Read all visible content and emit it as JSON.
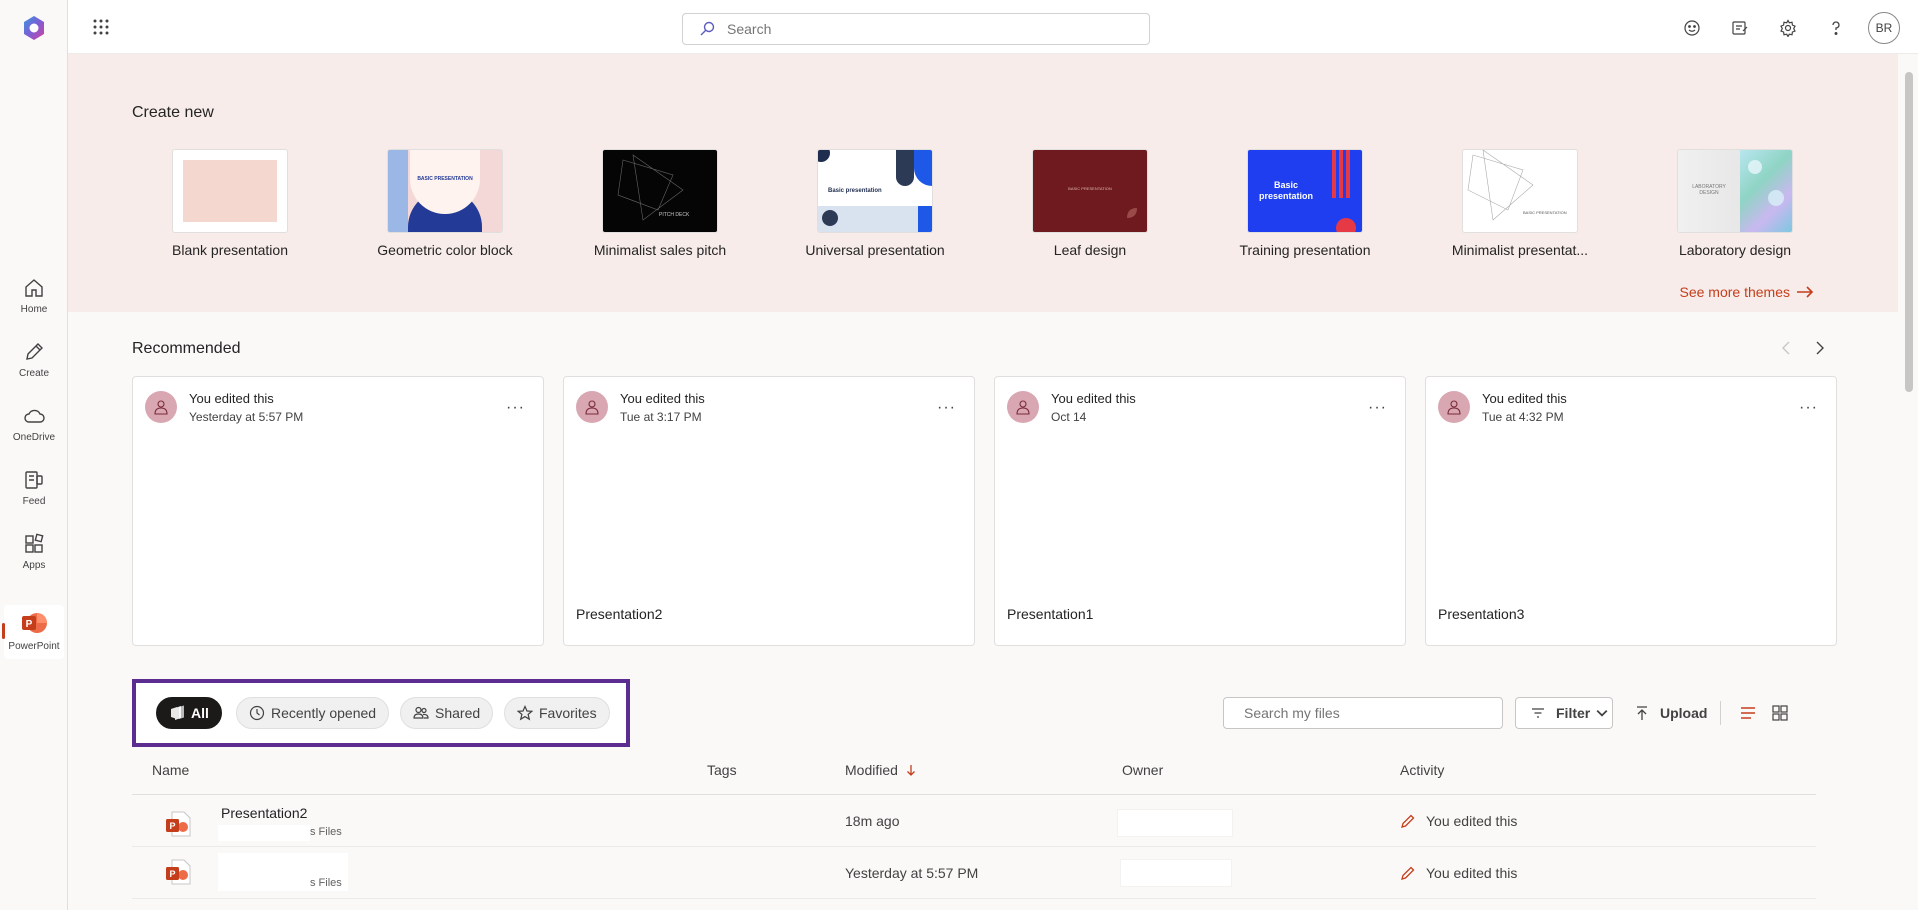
{
  "rail": {
    "items": [
      {
        "label": "Home",
        "icon": "home-icon"
      },
      {
        "label": "Create",
        "icon": "pen-icon"
      },
      {
        "label": "OneDrive",
        "icon": "cloud-icon"
      },
      {
        "label": "Feed",
        "icon": "feed-icon"
      },
      {
        "label": "Apps",
        "icon": "apps-icon"
      }
    ],
    "active_app": "PowerPoint"
  },
  "topbar": {
    "search_placeholder": "Search",
    "avatar_initials": "BR"
  },
  "create_new": {
    "title": "Create new",
    "templates": [
      {
        "label": "Blank presentation"
      },
      {
        "label": "Geometric color block",
        "inner_text": "BASIC PRESENTATION"
      },
      {
        "label": "Minimalist sales pitch",
        "inner_text": "PITCH DECK"
      },
      {
        "label": "Universal presentation",
        "inner_text": "Basic presentation"
      },
      {
        "label": "Leaf design",
        "inner_text": "BASIC PRESENTATION"
      },
      {
        "label": "Training presentation",
        "inner_text": "Basic presentation"
      },
      {
        "label": "Minimalist presentat...",
        "inner_text": "BASIC PRESENTATION"
      },
      {
        "label": "Laboratory design",
        "inner_text": "LABORATORY DESIGN"
      }
    ],
    "see_more": "See more themes"
  },
  "recommended": {
    "title": "Recommended",
    "cards": [
      {
        "who": "You edited this",
        "when": "Yesterday at 5:57 PM",
        "file": ""
      },
      {
        "who": "You edited this",
        "when": "Tue at 3:17 PM",
        "file": "Presentation2"
      },
      {
        "who": "You edited this",
        "when": "Oct 14",
        "file": "Presentation1"
      },
      {
        "who": "You edited this",
        "when": "Tue at 4:32 PM",
        "file": "Presentation3"
      }
    ]
  },
  "filters": {
    "pills": [
      {
        "label": "All",
        "active": true
      },
      {
        "label": "Recently opened",
        "active": false
      },
      {
        "label": "Shared",
        "active": false
      },
      {
        "label": "Favorites",
        "active": false
      }
    ],
    "search_placeholder": "Search my files",
    "filter_label": "Filter",
    "upload_label": "Upload"
  },
  "table": {
    "columns": [
      "Name",
      "Tags",
      "Modified",
      "Owner",
      "Activity"
    ],
    "rows": [
      {
        "name": "Presentation2",
        "location": "s Files",
        "modified": "18m ago",
        "activity": "You edited this"
      },
      {
        "name": "",
        "location": "s Files",
        "modified": "Yesterday at 5:57 PM",
        "activity": "You edited this"
      }
    ]
  },
  "colors": {
    "accent": "#c43e1c",
    "highlight_border": "#5c2d91",
    "create_bg": "#f7ece9"
  }
}
